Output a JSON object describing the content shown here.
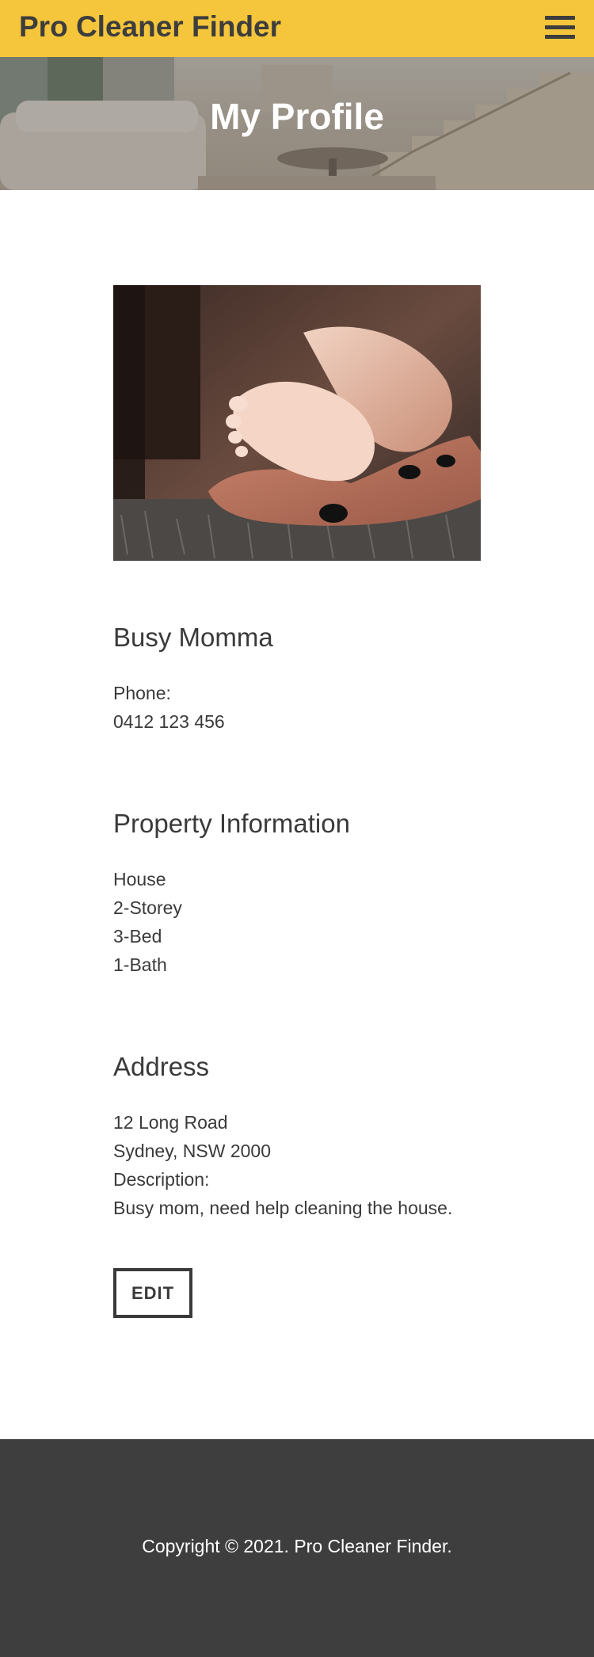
{
  "header": {
    "brand": "Pro Cleaner Finder",
    "menu_icon": "hamburger-menu-icon",
    "bg_color": "#f5c63b"
  },
  "hero": {
    "title": "My Profile"
  },
  "profile": {
    "photo_alt": "Baby feet held in a hand",
    "name": "Busy Momma",
    "phone_label": "Phone:",
    "phone": "0412 123 456"
  },
  "property": {
    "heading": "Property Information",
    "type": "House",
    "storeys": "2-Storey",
    "beds": "3-Bed",
    "baths": "1-Bath"
  },
  "address": {
    "heading": "Address",
    "street": "12 Long Road",
    "city": "Sydney, NSW 2000",
    "description_label": "Description:",
    "description": "Busy mom, need help cleaning the house."
  },
  "actions": {
    "edit_label": "EDIT"
  },
  "footer": {
    "copyright": "Copyright © 2021. Pro Cleaner Finder.",
    "bg_color": "#3e3e3e"
  }
}
